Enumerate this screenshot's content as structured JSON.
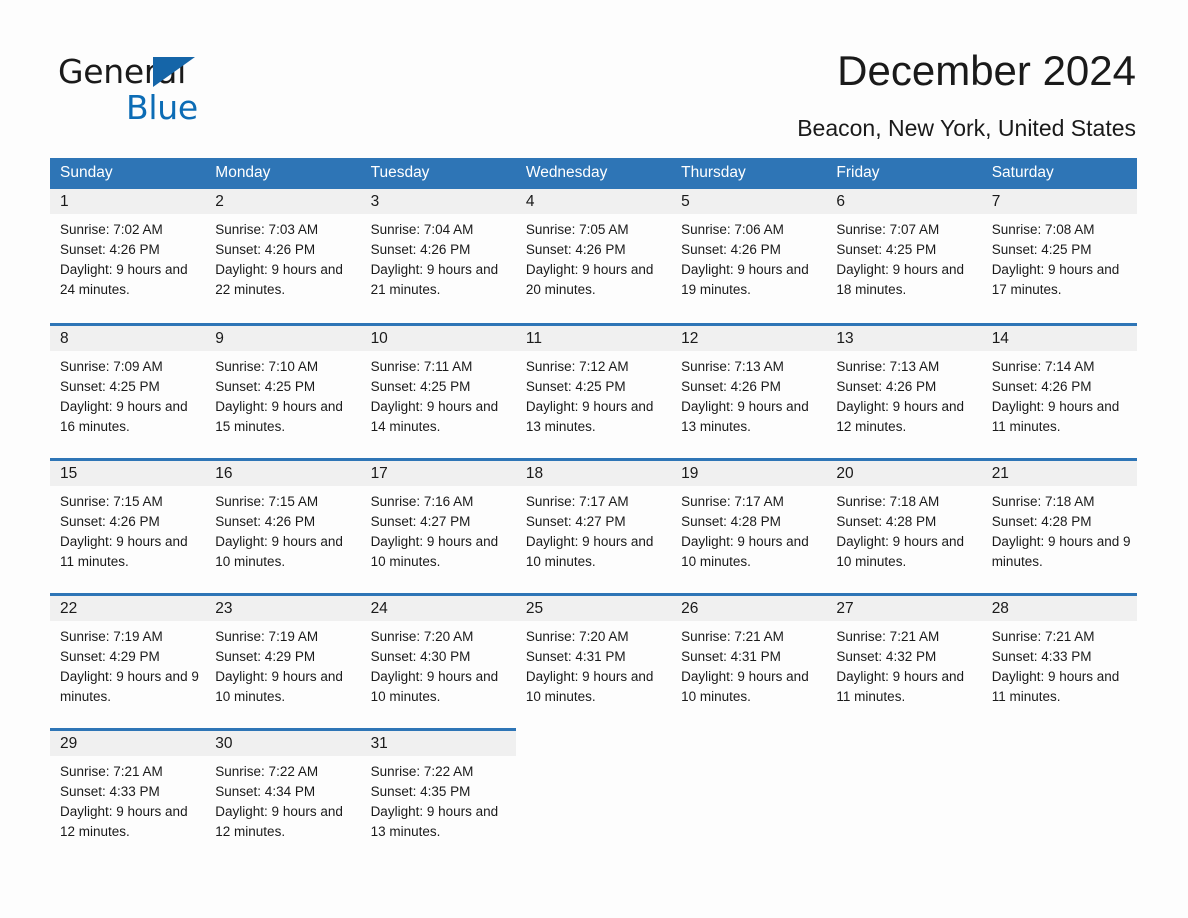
{
  "brand": {
    "name_part1": "General",
    "name_part2": "Blue",
    "accent_color": "#0c6cb5"
  },
  "header": {
    "title": "December 2024",
    "subtitle": "Beacon, New York, United States"
  },
  "theme": {
    "header_bg": "#2e75b6",
    "daynum_bg": "#f0f0f0",
    "page_bg": "#fdfdfd",
    "text": "#1a1a1a"
  },
  "weekdays": [
    "Sunday",
    "Monday",
    "Tuesday",
    "Wednesday",
    "Thursday",
    "Friday",
    "Saturday"
  ],
  "weeks": [
    [
      {
        "day": "1",
        "sunrise": "Sunrise: 7:02 AM",
        "sunset": "Sunset: 4:26 PM",
        "daylight": "Daylight: 9 hours and 24 minutes."
      },
      {
        "day": "2",
        "sunrise": "Sunrise: 7:03 AM",
        "sunset": "Sunset: 4:26 PM",
        "daylight": "Daylight: 9 hours and 22 minutes."
      },
      {
        "day": "3",
        "sunrise": "Sunrise: 7:04 AM",
        "sunset": "Sunset: 4:26 PM",
        "daylight": "Daylight: 9 hours and 21 minutes."
      },
      {
        "day": "4",
        "sunrise": "Sunrise: 7:05 AM",
        "sunset": "Sunset: 4:26 PM",
        "daylight": "Daylight: 9 hours and 20 minutes."
      },
      {
        "day": "5",
        "sunrise": "Sunrise: 7:06 AM",
        "sunset": "Sunset: 4:26 PM",
        "daylight": "Daylight: 9 hours and 19 minutes."
      },
      {
        "day": "6",
        "sunrise": "Sunrise: 7:07 AM",
        "sunset": "Sunset: 4:25 PM",
        "daylight": "Daylight: 9 hours and 18 minutes."
      },
      {
        "day": "7",
        "sunrise": "Sunrise: 7:08 AM",
        "sunset": "Sunset: 4:25 PM",
        "daylight": "Daylight: 9 hours and 17 minutes."
      }
    ],
    [
      {
        "day": "8",
        "sunrise": "Sunrise: 7:09 AM",
        "sunset": "Sunset: 4:25 PM",
        "daylight": "Daylight: 9 hours and 16 minutes."
      },
      {
        "day": "9",
        "sunrise": "Sunrise: 7:10 AM",
        "sunset": "Sunset: 4:25 PM",
        "daylight": "Daylight: 9 hours and 15 minutes."
      },
      {
        "day": "10",
        "sunrise": "Sunrise: 7:11 AM",
        "sunset": "Sunset: 4:25 PM",
        "daylight": "Daylight: 9 hours and 14 minutes."
      },
      {
        "day": "11",
        "sunrise": "Sunrise: 7:12 AM",
        "sunset": "Sunset: 4:25 PM",
        "daylight": "Daylight: 9 hours and 13 minutes."
      },
      {
        "day": "12",
        "sunrise": "Sunrise: 7:13 AM",
        "sunset": "Sunset: 4:26 PM",
        "daylight": "Daylight: 9 hours and 13 minutes."
      },
      {
        "day": "13",
        "sunrise": "Sunrise: 7:13 AM",
        "sunset": "Sunset: 4:26 PM",
        "daylight": "Daylight: 9 hours and 12 minutes."
      },
      {
        "day": "14",
        "sunrise": "Sunrise: 7:14 AM",
        "sunset": "Sunset: 4:26 PM",
        "daylight": "Daylight: 9 hours and 11 minutes."
      }
    ],
    [
      {
        "day": "15",
        "sunrise": "Sunrise: 7:15 AM",
        "sunset": "Sunset: 4:26 PM",
        "daylight": "Daylight: 9 hours and 11 minutes."
      },
      {
        "day": "16",
        "sunrise": "Sunrise: 7:15 AM",
        "sunset": "Sunset: 4:26 PM",
        "daylight": "Daylight: 9 hours and 10 minutes."
      },
      {
        "day": "17",
        "sunrise": "Sunrise: 7:16 AM",
        "sunset": "Sunset: 4:27 PM",
        "daylight": "Daylight: 9 hours and 10 minutes."
      },
      {
        "day": "18",
        "sunrise": "Sunrise: 7:17 AM",
        "sunset": "Sunset: 4:27 PM",
        "daylight": "Daylight: 9 hours and 10 minutes."
      },
      {
        "day": "19",
        "sunrise": "Sunrise: 7:17 AM",
        "sunset": "Sunset: 4:28 PM",
        "daylight": "Daylight: 9 hours and 10 minutes."
      },
      {
        "day": "20",
        "sunrise": "Sunrise: 7:18 AM",
        "sunset": "Sunset: 4:28 PM",
        "daylight": "Daylight: 9 hours and 10 minutes."
      },
      {
        "day": "21",
        "sunrise": "Sunrise: 7:18 AM",
        "sunset": "Sunset: 4:28 PM",
        "daylight": "Daylight: 9 hours and 9 minutes."
      }
    ],
    [
      {
        "day": "22",
        "sunrise": "Sunrise: 7:19 AM",
        "sunset": "Sunset: 4:29 PM",
        "daylight": "Daylight: 9 hours and 9 minutes."
      },
      {
        "day": "23",
        "sunrise": "Sunrise: 7:19 AM",
        "sunset": "Sunset: 4:29 PM",
        "daylight": "Daylight: 9 hours and 10 minutes."
      },
      {
        "day": "24",
        "sunrise": "Sunrise: 7:20 AM",
        "sunset": "Sunset: 4:30 PM",
        "daylight": "Daylight: 9 hours and 10 minutes."
      },
      {
        "day": "25",
        "sunrise": "Sunrise: 7:20 AM",
        "sunset": "Sunset: 4:31 PM",
        "daylight": "Daylight: 9 hours and 10 minutes."
      },
      {
        "day": "26",
        "sunrise": "Sunrise: 7:21 AM",
        "sunset": "Sunset: 4:31 PM",
        "daylight": "Daylight: 9 hours and 10 minutes."
      },
      {
        "day": "27",
        "sunrise": "Sunrise: 7:21 AM",
        "sunset": "Sunset: 4:32 PM",
        "daylight": "Daylight: 9 hours and 11 minutes."
      },
      {
        "day": "28",
        "sunrise": "Sunrise: 7:21 AM",
        "sunset": "Sunset: 4:33 PM",
        "daylight": "Daylight: 9 hours and 11 minutes."
      }
    ],
    [
      {
        "day": "29",
        "sunrise": "Sunrise: 7:21 AM",
        "sunset": "Sunset: 4:33 PM",
        "daylight": "Daylight: 9 hours and 12 minutes."
      },
      {
        "day": "30",
        "sunrise": "Sunrise: 7:22 AM",
        "sunset": "Sunset: 4:34 PM",
        "daylight": "Daylight: 9 hours and 12 minutes."
      },
      {
        "day": "31",
        "sunrise": "Sunrise: 7:22 AM",
        "sunset": "Sunset: 4:35 PM",
        "daylight": "Daylight: 9 hours and 13 minutes."
      },
      {
        "day": "",
        "sunrise": "",
        "sunset": "",
        "daylight": ""
      },
      {
        "day": "",
        "sunrise": "",
        "sunset": "",
        "daylight": ""
      },
      {
        "day": "",
        "sunrise": "",
        "sunset": "",
        "daylight": ""
      },
      {
        "day": "",
        "sunrise": "",
        "sunset": "",
        "daylight": ""
      }
    ]
  ]
}
